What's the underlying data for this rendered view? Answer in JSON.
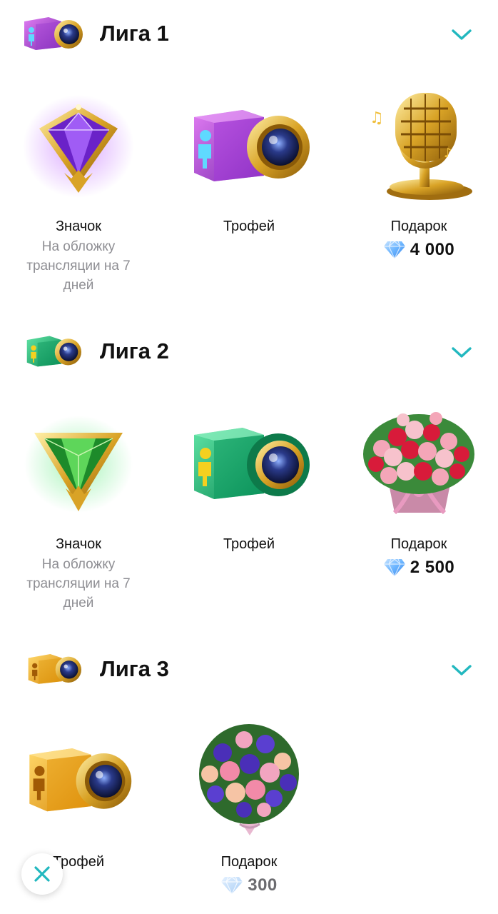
{
  "leagues": [
    {
      "title": "Лига 1",
      "accent": "#a43fd6",
      "badge_label": "Значок",
      "badge_desc": "На обложку трансляции на 7 дней",
      "trophy_label": "Трофей",
      "gift_label": "Подарок",
      "gift_price": "4 000",
      "gift_icon": "golden-microphone-icon"
    },
    {
      "title": "Лига 2",
      "accent": "#19b36a",
      "badge_label": "Значок",
      "badge_desc": "На обложку трансляции на 7 дней",
      "trophy_label": "Трофей",
      "gift_label": "Подарок",
      "gift_price": "2 500",
      "gift_icon": "rose-bouquet-basket-icon"
    },
    {
      "title": "Лига 3",
      "accent": "#f0a91c",
      "trophy_label": "Трофей",
      "gift_label": "Подарок",
      "gift_price": "300",
      "gift_icon": "flower-bouquet-icon"
    }
  ],
  "colors": {
    "chevron": "#22b8bf",
    "diamond": "#5aa9ff",
    "close": "#22b8bf"
  },
  "close_icon": "close-icon"
}
